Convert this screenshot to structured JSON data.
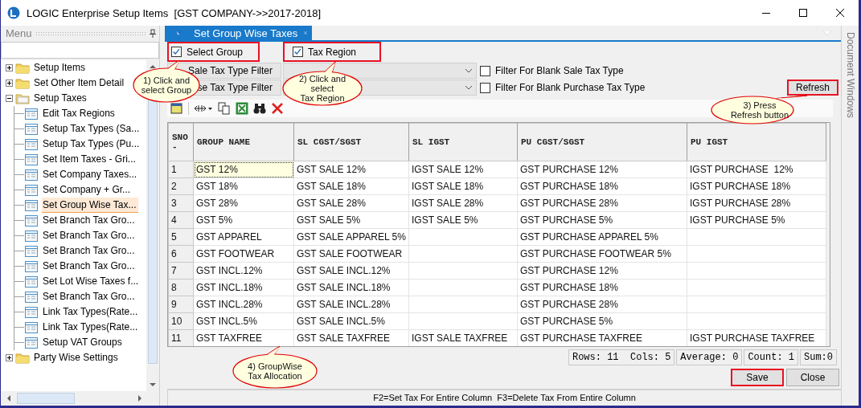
{
  "window": {
    "title": "LOGIC Enterprise Setup Items  [GST COMPANY->>2017-2018]"
  },
  "menu": {
    "title": "Menu",
    "tree": [
      {
        "label": "Setup Items",
        "kind": "folder",
        "expanded": false,
        "selected": false
      },
      {
        "label": "Set Other Item Detail",
        "kind": "folder",
        "expanded": false,
        "selected": false
      },
      {
        "label": "Setup Taxes",
        "kind": "folder",
        "expanded": true,
        "selected": false,
        "children": [
          {
            "label": "Edit Tax Regions",
            "kind": "form",
            "selected": false
          },
          {
            "label": "Setup Tax Types (Sa...",
            "kind": "form",
            "selected": false
          },
          {
            "label": "Setup Tax Types (Pu...",
            "kind": "form",
            "selected": false
          },
          {
            "label": "Set Item Taxes - Gri...",
            "kind": "form",
            "selected": false
          },
          {
            "label": "Set Company Taxes...",
            "kind": "form",
            "selected": false
          },
          {
            "label": "Set Company + Gr...",
            "kind": "form",
            "selected": false
          },
          {
            "label": "Set Group Wise Tax...",
            "kind": "form",
            "selected": true
          },
          {
            "label": "Set Branch Tax Gro...",
            "kind": "form",
            "selected": false
          },
          {
            "label": "Set Branch Tax Gro...",
            "kind": "form",
            "selected": false
          },
          {
            "label": "Set Branch Tax Gro...",
            "kind": "form",
            "selected": false
          },
          {
            "label": "Set Branch Tax Gro...",
            "kind": "form",
            "selected": false
          },
          {
            "label": "Set Lot Wise Taxes f...",
            "kind": "form",
            "selected": false
          },
          {
            "label": "Set Branch Tax Gro...",
            "kind": "form",
            "selected": false
          },
          {
            "label": "Link Tax Types(Rate...",
            "kind": "form",
            "selected": false
          },
          {
            "label": "Link Tax Types(Rate...",
            "kind": "form",
            "selected": false
          },
          {
            "label": "Setup VAT Groups",
            "kind": "form",
            "selected": false
          }
        ]
      },
      {
        "label": "Party Wise Settings",
        "kind": "folder",
        "expanded": false,
        "selected": false
      }
    ]
  },
  "tab": {
    "label": "Set Group Wise Taxes",
    "selected": true
  },
  "side_strip": {
    "label": "Document Windows"
  },
  "options": [
    {
      "label": "Select Group",
      "checked": true,
      "highlighted": true
    },
    {
      "label": "Tax Region",
      "checked": true,
      "highlighted": true
    }
  ],
  "filters": [
    {
      "label": "Sale Tax Type Filter",
      "blank_filter": {
        "label": "Filter For Blank Sale Tax Type",
        "checked": false
      }
    },
    {
      "label": "se Tax Type Filter",
      "blank_filter": {
        "label": "Filter For Blank Purchase Tax Type",
        "checked": false
      }
    }
  ],
  "refresh_button": {
    "label": "Refresh",
    "highlighted": true
  },
  "table": {
    "columns": [
      "SNO\n-",
      "GROUP NAME",
      "SL CGST/SGST",
      "SL IGST",
      "PU CGST/SGST",
      "PU IGST"
    ],
    "rows": [
      {
        "cells": [
          {
            "text": "1",
            "selected": false
          },
          {
            "text": "GST 12%",
            "selected": true
          },
          {
            "text": "GST SALE 12%",
            "selected": false
          },
          {
            "text": "IGST SALE 12%",
            "selected": false
          },
          {
            "text": "GST PURCHASE 12%",
            "selected": false
          },
          {
            "text": "IGST PURCHASE  12%",
            "selected": false
          }
        ]
      },
      {
        "cells": [
          {
            "text": "2",
            "selected": false
          },
          {
            "text": "GST 18%",
            "selected": false
          },
          {
            "text": "GST SALE 18%",
            "selected": false
          },
          {
            "text": "IGST SALE 18%",
            "selected": false
          },
          {
            "text": "GST PURCHASE 18%",
            "selected": false
          },
          {
            "text": "IGST PURCHASE 18%",
            "selected": false
          }
        ]
      },
      {
        "cells": [
          {
            "text": "3",
            "selected": false
          },
          {
            "text": "GST 28%",
            "selected": false
          },
          {
            "text": "GST SALE 28%",
            "selected": false
          },
          {
            "text": "IGST SALE 28%",
            "selected": false
          },
          {
            "text": "GST PURCHASE 28%",
            "selected": false
          },
          {
            "text": "IGST PURCHASE 28%",
            "selected": false
          }
        ]
      },
      {
        "cells": [
          {
            "text": "4",
            "selected": false
          },
          {
            "text": "GST 5%",
            "selected": false
          },
          {
            "text": "GST SALE 5%",
            "selected": false
          },
          {
            "text": "IGST SALE 5%",
            "selected": false
          },
          {
            "text": "GST PURCHASE 5%",
            "selected": false
          },
          {
            "text": "IGST PURCHASE 5%",
            "selected": false
          }
        ]
      },
      {
        "cells": [
          {
            "text": "5",
            "selected": false
          },
          {
            "text": "GST APPAREL",
            "selected": false
          },
          {
            "text": "GST SALE APPAREL 5%",
            "selected": false
          },
          {
            "selected": false
          },
          {
            "text": "GST PURCHASE APPAREL 5%",
            "selected": false
          },
          {
            "selected": false
          }
        ]
      },
      {
        "cells": [
          {
            "text": "6",
            "selected": false
          },
          {
            "text": "GST FOOTWEAR",
            "selected": false
          },
          {
            "text": "GST SALE FOOTWEAR",
            "selected": false
          },
          {
            "selected": false
          },
          {
            "text": "GST PURCHASE FOOTWEAR 5%",
            "selected": false
          },
          {
            "selected": false
          }
        ]
      },
      {
        "cells": [
          {
            "text": "7",
            "selected": false
          },
          {
            "text": "GST INCL.12%",
            "selected": false
          },
          {
            "text": "GST SALE INCL.12%",
            "selected": false
          },
          {
            "selected": false
          },
          {
            "text": "GST PURCHASE 12%",
            "selected": false
          },
          {
            "selected": false
          }
        ]
      },
      {
        "cells": [
          {
            "text": "8",
            "selected": false
          },
          {
            "text": "GST INCL.18%",
            "selected": false
          },
          {
            "text": "GST SALE INCL.18%",
            "selected": false
          },
          {
            "selected": false
          },
          {
            "text": "GST PURCHASE 18%",
            "selected": false
          },
          {
            "selected": false
          }
        ]
      },
      {
        "cells": [
          {
            "text": "9",
            "selected": false
          },
          {
            "text": "GST INCL.28%",
            "selected": false
          },
          {
            "text": "GST SALE INCL.28%",
            "selected": false
          },
          {
            "selected": false
          },
          {
            "text": "GST PURCHASE 28%",
            "selected": false
          },
          {
            "selected": false
          }
        ]
      },
      {
        "cells": [
          {
            "text": "10",
            "selected": false
          },
          {
            "text": "GST INCL.5%",
            "selected": false
          },
          {
            "text": "GST SALE INCL.5%",
            "selected": false
          },
          {
            "selected": false
          },
          {
            "text": "GST PURCHASE 5%",
            "selected": false
          },
          {
            "selected": false
          }
        ]
      },
      {
        "cells": [
          {
            "text": "11",
            "selected": false
          },
          {
            "text": "GST TAXFREE",
            "selected": false
          },
          {
            "text": "GST SALE TAXFREE",
            "selected": false
          },
          {
            "text": "IGST SALE TAXFREE",
            "selected": false
          },
          {
            "text": "GST PURCHASE TAXFREE",
            "selected": false
          },
          {
            "text": "IGST PURCHASE TAXFREE",
            "selected": false
          }
        ]
      }
    ]
  },
  "status_cells": [
    "Rows: 11  Cols: 5",
    "Average: 0",
    "Count: 1",
    "Sum:0"
  ],
  "buttons": [
    {
      "label": "Save",
      "highlighted": true
    },
    {
      "label": "Close",
      "highlighted": false
    }
  ],
  "hint": "F2=Set Tax For Entire Column  F3=Delete Tax From Entire Column",
  "callouts": [
    {
      "text": "1) Click and\nselect Group"
    },
    {
      "text": "2) Click and\nselect\nTax Region"
    },
    {
      "text": "3) Press\nRefresh button"
    },
    {
      "text": "4) GroupWise\nTax Allocation"
    }
  ]
}
